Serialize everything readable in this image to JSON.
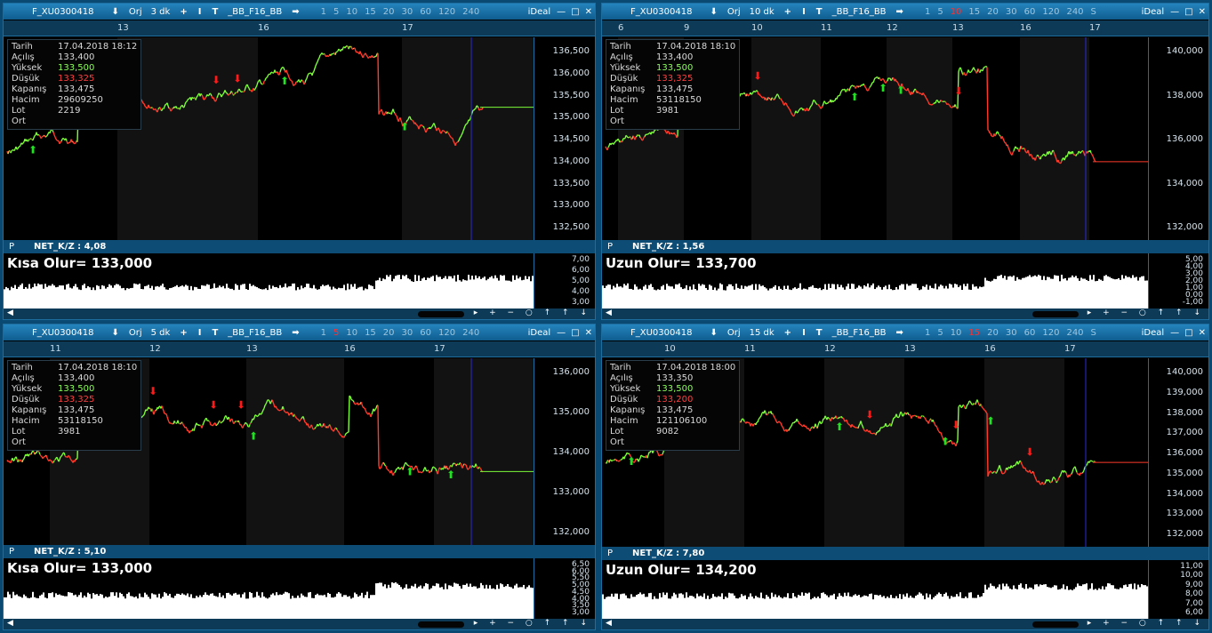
{
  "panels": [
    {
      "symbol": "F_XU0300418",
      "mode": "Orj",
      "interval": "3 dk",
      "template": "_BB_F16_BB",
      "periods": [
        "1",
        "5",
        "10",
        "15",
        "20",
        "30",
        "60",
        "120",
        "240"
      ],
      "active_period": "",
      "brand": "iDeal",
      "dates": [
        "13",
        "16",
        "17"
      ],
      "info": {
        "Tarih": "17.04.2018 18:12",
        "Açılış": "133,400",
        "Yüksek": "133,500",
        "Düşük": "133,325",
        "Kapanış": "133,475",
        "Hacim": "29609250",
        "Lot": "2219",
        "Ort": ""
      },
      "price_axis": [
        "136,500",
        "136,000",
        "135,500",
        "135,000",
        "134,500",
        "134,000",
        "133,500",
        "133,000",
        "132,500"
      ],
      "indicator": {
        "name": "NET_K/Z : 4,08",
        "signal": "Kısa Olur= 133,000",
        "axis": [
          "7,00",
          "6,00",
          "5,00",
          "4,00",
          "3,00"
        ]
      }
    },
    {
      "symbol": "F_XU0300418",
      "mode": "Orj",
      "interval": "10 dk",
      "template": "_BB_F16_BB",
      "periods": [
        "1",
        "5",
        "10",
        "15",
        "20",
        "30",
        "60",
        "120",
        "240",
        "S"
      ],
      "active_period": "10",
      "brand": "iDeal",
      "dates": [
        "6",
        "9",
        "10",
        "11",
        "12",
        "13",
        "16",
        "17"
      ],
      "info": {
        "Tarih": "17.04.2018 18:10",
        "Açılış": "133,400",
        "Yüksek": "133,500",
        "Düşük": "133,325",
        "Kapanış": "133,475",
        "Hacim": "53118150",
        "Lot": "3981",
        "Ort": ""
      },
      "price_axis": [
        "140,000",
        "138,000",
        "136,000",
        "134,000",
        "132,000"
      ],
      "indicator": {
        "name": "NET_K/Z : 1,56",
        "signal": "Uzun Olur= 133,700",
        "axis": [
          "5,00",
          "4,00",
          "3,00",
          "2,00",
          "1,00",
          "0,00",
          "-1,00"
        ]
      }
    },
    {
      "symbol": "F_XU0300418",
      "mode": "Orj",
      "interval": "5 dk",
      "template": "_BB_F16_BB",
      "periods": [
        "1",
        "5",
        "10",
        "15",
        "20",
        "30",
        "60",
        "120",
        "240"
      ],
      "active_period": "5",
      "brand": "iDeal",
      "dates": [
        "11",
        "12",
        "13",
        "16",
        "17"
      ],
      "info": {
        "Tarih": "17.04.2018 18:10",
        "Açılış": "133,400",
        "Yüksek": "133,500",
        "Düşük": "133,325",
        "Kapanış": "133,475",
        "Hacim": "53118150",
        "Lot": "3981",
        "Ort": ""
      },
      "price_axis": [
        "136,000",
        "135,000",
        "134,000",
        "133,000",
        "132,000"
      ],
      "indicator": {
        "name": "NET_K/Z : 5,10",
        "signal": "Kısa Olur= 133,000",
        "axis": [
          "6,50",
          "6,00",
          "5,50",
          "5,00",
          "4,50",
          "4,00",
          "3,50",
          "3,00"
        ]
      }
    },
    {
      "symbol": "F_XU0300418",
      "mode": "Orj",
      "interval": "15 dk",
      "template": "_BB_F16_BB",
      "periods": [
        "1",
        "5",
        "10",
        "15",
        "20",
        "30",
        "60",
        "120",
        "240",
        "S"
      ],
      "active_period": "15",
      "brand": "iDeal",
      "dates": [
        "10",
        "11",
        "12",
        "13",
        "16",
        "17"
      ],
      "info": {
        "Tarih": "17.04.2018 18:00",
        "Açılış": "133,350",
        "Yüksek": "133,500",
        "Düşük": "133,200",
        "Kapanış": "133,475",
        "Hacim": "121106100",
        "Lot": "9082",
        "Ort": ""
      },
      "price_axis": [
        "140,000",
        "139,000",
        "138,000",
        "137,000",
        "136,000",
        "135,000",
        "134,000",
        "133,000",
        "132,000"
      ],
      "indicator": {
        "name": "NET_K/Z : 7,80",
        "signal": "Uzun Olur= 134,200",
        "axis": [
          "11,00",
          "10,00",
          "9,00",
          "8,00",
          "7,00",
          "6,00"
        ]
      }
    }
  ],
  "colors": {
    "up": "#7cfc3a",
    "down": "#ff3a2a",
    "buy_arrow": "#22e022",
    "sell_arrow": "#ff1a1a",
    "grid_dark": "#000000",
    "grid_alt": "#141414",
    "titlebar": "#1f7ab2"
  },
  "icons": {
    "down": "download-arrow-icon",
    "plus": "plus-icon",
    "cursor": "cursor-icon",
    "text": "text-icon",
    "forward": "forward-arrow-icon"
  }
}
